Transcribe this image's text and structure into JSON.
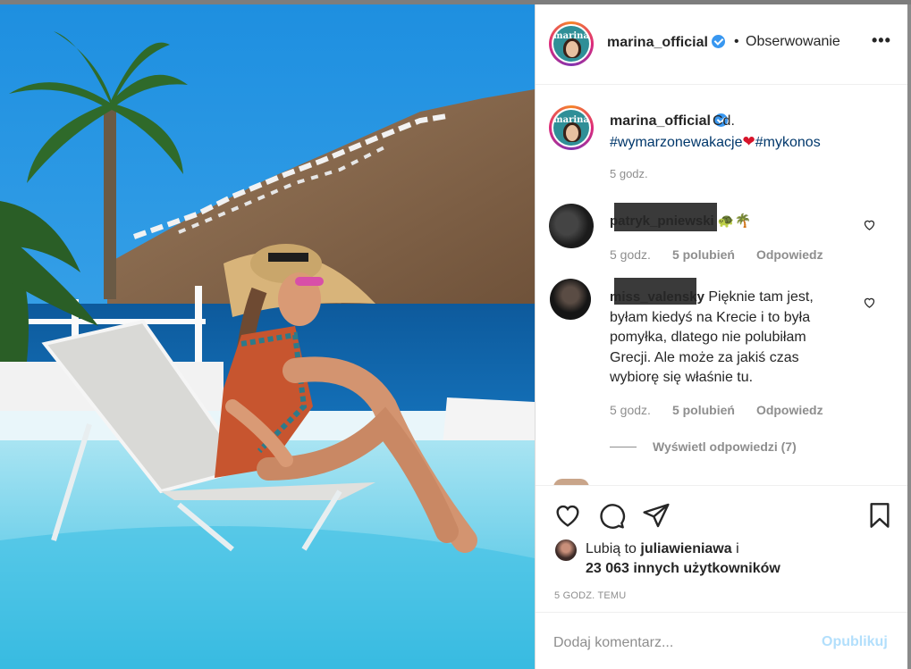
{
  "post": {
    "username": "marina_official",
    "avatar_text": "marina",
    "follow_separator": "•",
    "follow_status": "Obserwowanie",
    "more_icon": "more-icon"
  },
  "caption": {
    "username": "marina_official",
    "more": "Cd.",
    "hashtag1": "#wymarzonewakacje",
    "heart": "❤",
    "hashtag2": "#mykonos",
    "time": "5 godz."
  },
  "comments": [
    {
      "username": "patryk_pniewski",
      "text": "🐢🌴",
      "time": "5 godz.",
      "likes": "5 polubień",
      "reply": "Odpowiedz"
    },
    {
      "username": "miss_valensky",
      "text_lines": [
        "Pięknie tam jest,",
        "byłam kiedyś na Krecie i to była",
        "pomyłka, dlatego nie polubiłam",
        "Grecji. Ale może za jakiś czas",
        "wybiorę się właśnie tu."
      ],
      "time": "5 godz.",
      "likes": "5 polubień",
      "reply": "Odpowiedz",
      "view_replies": "Wyświetl odpowiedzi (7)"
    }
  ],
  "likes": {
    "line1_prefix": "Lubią to",
    "liker": "juliawieniawa",
    "line1_suffix": "i",
    "line2": "23 063 innych użytkowników"
  },
  "timestamp": "5 GODZ. TEMU",
  "add_comment": {
    "placeholder": "Dodaj komentarz...",
    "publish": "Opublikuj"
  },
  "colors": {
    "link": "#00376b",
    "verified": "#3897f0",
    "muted": "#8e8e8e",
    "publish_disabled": "#b2dffc"
  }
}
